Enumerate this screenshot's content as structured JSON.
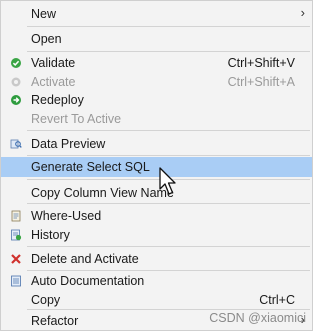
{
  "menu": {
    "new": {
      "label": "New",
      "icon": "submenu-arrow"
    },
    "open": {
      "label": "Open"
    },
    "validate": {
      "label": "Validate",
      "shortcut": "Ctrl+Shift+V",
      "icon": "validate-icon"
    },
    "activate": {
      "label": "Activate",
      "shortcut": "Ctrl+Shift+A",
      "icon": "activate-icon"
    },
    "redeploy": {
      "label": "Redeploy",
      "icon": "redeploy-icon"
    },
    "revert": {
      "label": "Revert To Active"
    },
    "data_preview": {
      "label": "Data Preview",
      "icon": "data-preview-icon"
    },
    "generate_sql": {
      "label": "Generate Select SQL"
    },
    "copy_column": {
      "label": "Copy Column View Name"
    },
    "where_used": {
      "label": "Where-Used",
      "icon": "where-used-icon"
    },
    "history": {
      "label": "History",
      "icon": "history-icon"
    },
    "delete_activate": {
      "label": "Delete and Activate",
      "icon": "delete-icon"
    },
    "auto_doc": {
      "label": "Auto Documentation",
      "icon": "document-icon"
    },
    "copy": {
      "label": "Copy",
      "shortcut": "Ctrl+C"
    },
    "refactor": {
      "label": "Refactor",
      "icon": "submenu-arrow"
    }
  },
  "watermark": "CSDN @xiaomici",
  "colors": {
    "highlight": "#a9cdf5",
    "background": "#f3f3f3",
    "separator": "#d3d3d3"
  }
}
